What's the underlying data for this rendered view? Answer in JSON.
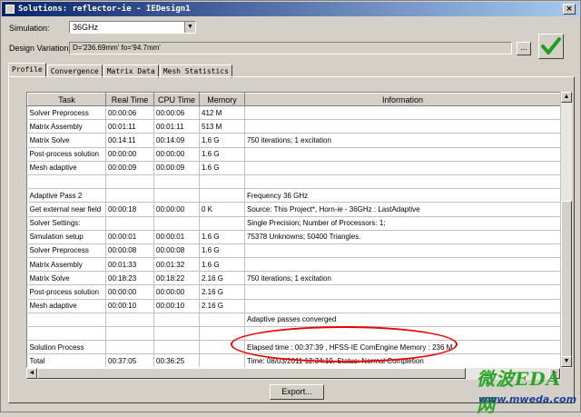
{
  "window": {
    "title": "Solutions: reflector-ie - IEDesign1",
    "close_glyph": "×"
  },
  "simulation": {
    "label": "Simulation:",
    "value": "36GHz"
  },
  "design_variation": {
    "label": "Design Variation:",
    "value": "D='236.69mm' fo='94.7mm'",
    "browse_label": "..."
  },
  "tabs": [
    {
      "label": "Profile",
      "active": true
    },
    {
      "label": "Convergence",
      "active": false
    },
    {
      "label": "Matrix Data",
      "active": false
    },
    {
      "label": "Mesh Statistics",
      "active": false
    }
  ],
  "table": {
    "columns": [
      "Task",
      "Real Time",
      "CPU Time",
      "Memory",
      "Information"
    ],
    "rows": [
      [
        "Solver Preprocess",
        "00:00:06",
        "00:00:06",
        "412 M",
        ""
      ],
      [
        "Matrix Assembly",
        "00:01:11",
        "00:01:11",
        "513 M",
        ""
      ],
      [
        "Matrix Solve",
        "00:14:11",
        "00:14:09",
        "1.6 G",
        "750 iterations;   1 excitation"
      ],
      [
        "Post-process solution",
        "00:00:00",
        "00:00:00",
        "1.6 G",
        ""
      ],
      [
        "Mesh adaptive",
        "00:00:09",
        "00:00:09",
        "1.6 G",
        ""
      ],
      [
        "",
        "",
        "",
        "",
        ""
      ],
      [
        "Adaptive Pass 2",
        "",
        "",
        "",
        "Frequency 36 GHz"
      ],
      [
        "Get external near field",
        "00:00:18",
        "00:00:00",
        "0 K",
        "Source: This Project*, Horn-ie - 36GHz : LastAdaptive"
      ],
      [
        "Solver Settings:",
        "",
        "",
        "",
        "Single Precision;  Number of Processors: 1;"
      ],
      [
        "Simulation setup",
        "00:00:01",
        "00:00:01",
        "1.6 G",
        "75378 Unknowns; 50400 Triangles."
      ],
      [
        "Solver Preprocess",
        "00:00:08",
        "00:00:08",
        "1.6 G",
        ""
      ],
      [
        "Matrix Assembly",
        "00:01:33",
        "00:01:32",
        "1.6 G",
        ""
      ],
      [
        "Matrix Solve",
        "00:18:23",
        "00:18:22",
        "2.16 G",
        "750 iterations;   1 excitation"
      ],
      [
        "Post-process solution",
        "00:00:00",
        "00:00:00",
        "2.16 G",
        ""
      ],
      [
        "Mesh adaptive",
        "00:00:10",
        "00:00:10",
        "2.16 G",
        ""
      ],
      [
        "",
        "",
        "",
        "",
        "Adaptive passes converged"
      ],
      [
        "",
        "",
        "",
        "",
        ""
      ],
      [
        "Solution Process",
        "",
        "",
        "",
        "Elapsed time : 00:37:39 ,  HFSS-IE ComEngine Memory : 236 M"
      ],
      [
        "Total",
        "00:37:05",
        "00:36:25",
        "",
        "Time:  08/03/2011 12:34:19, Status: Normal Completion"
      ],
      [
        "",
        "",
        "",
        "",
        ""
      ]
    ]
  },
  "export_button": {
    "label": "Export..."
  },
  "watermark": {
    "text": "微波EDA网",
    "url": "www.mweda.com"
  },
  "colors": {
    "highlight_oval": "#e00000",
    "check": "#1f9d1f",
    "watermark_green": "#2aa52a",
    "watermark_blue": "#1f3f99"
  },
  "scroll": {
    "vertical_arrow_up": "▲",
    "vertical_arrow_down": "▼",
    "horizontal_arrow_left": "◄",
    "horizontal_arrow_right": "►",
    "combo_arrow": "▼"
  }
}
